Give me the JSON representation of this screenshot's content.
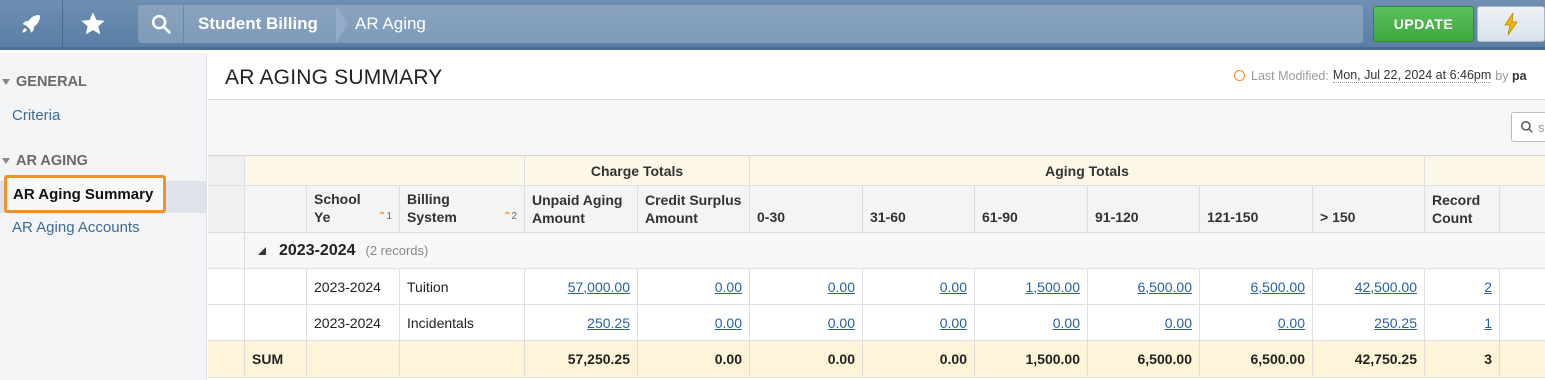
{
  "topbar": {
    "breadcrumb": [
      "Student Billing",
      "AR Aging"
    ],
    "update_label": "UPDATE",
    "icons": [
      "rocket-icon",
      "star-icon",
      "search-icon",
      "lightning-icon"
    ]
  },
  "sidebar": {
    "sections": [
      {
        "title": "GENERAL",
        "items": [
          "Criteria"
        ]
      },
      {
        "title": "AR AGING",
        "items": [
          "AR Aging Summary",
          "AR Aging Accounts"
        ]
      }
    ],
    "active_item": "AR Aging Summary"
  },
  "page": {
    "title": "AR AGING SUMMARY",
    "last_modified_label": "Last Modified:",
    "last_modified_date": "Mon, Jul 22, 2024 at 6:46pm",
    "by_label": "by",
    "by_name": "pa",
    "grid_search_placeholder": "s"
  },
  "grid": {
    "groups": {
      "charge_totals": "Charge Totals",
      "aging_totals": "Aging Totals"
    },
    "columns": {
      "school_year": "School Ye",
      "school_year_sort": "1",
      "billing_system": "Billing System",
      "billing_system_sort": "2",
      "unpaid": "Unpaid Aging Amount",
      "credit": "Credit Surplus Amount",
      "b0_30": "0-30",
      "b31_60": "31-60",
      "b61_90": "61-90",
      "b91_120": "91-120",
      "b121_150": "121-150",
      "b150": "> 150",
      "record_count": "Record Count"
    },
    "group_row": {
      "label": "2023-2024",
      "count": "(2 records)"
    },
    "rows": [
      {
        "school_year": "2023-2024",
        "billing_system": "Tuition",
        "unpaid": "57,000.00",
        "credit": "0.00",
        "b0_30": "0.00",
        "b31_60": "0.00",
        "b61_90": "1,500.00",
        "b91_120": "6,500.00",
        "b121_150": "6,500.00",
        "b150": "42,500.00",
        "record_count": "2"
      },
      {
        "school_year": "2023-2024",
        "billing_system": "Incidentals",
        "unpaid": "250.25",
        "credit": "0.00",
        "b0_30": "0.00",
        "b31_60": "0.00",
        "b61_90": "0.00",
        "b91_120": "0.00",
        "b121_150": "0.00",
        "b150": "250.25",
        "record_count": "1"
      }
    ],
    "sum_row": {
      "label": "SUM",
      "unpaid": "57,250.25",
      "credit": "0.00",
      "b0_30": "0.00",
      "b31_60": "0.00",
      "b61_90": "1,500.00",
      "b91_120": "6,500.00",
      "b121_150": "6,500.00",
      "b150": "42,750.25",
      "record_count": "3"
    }
  }
}
